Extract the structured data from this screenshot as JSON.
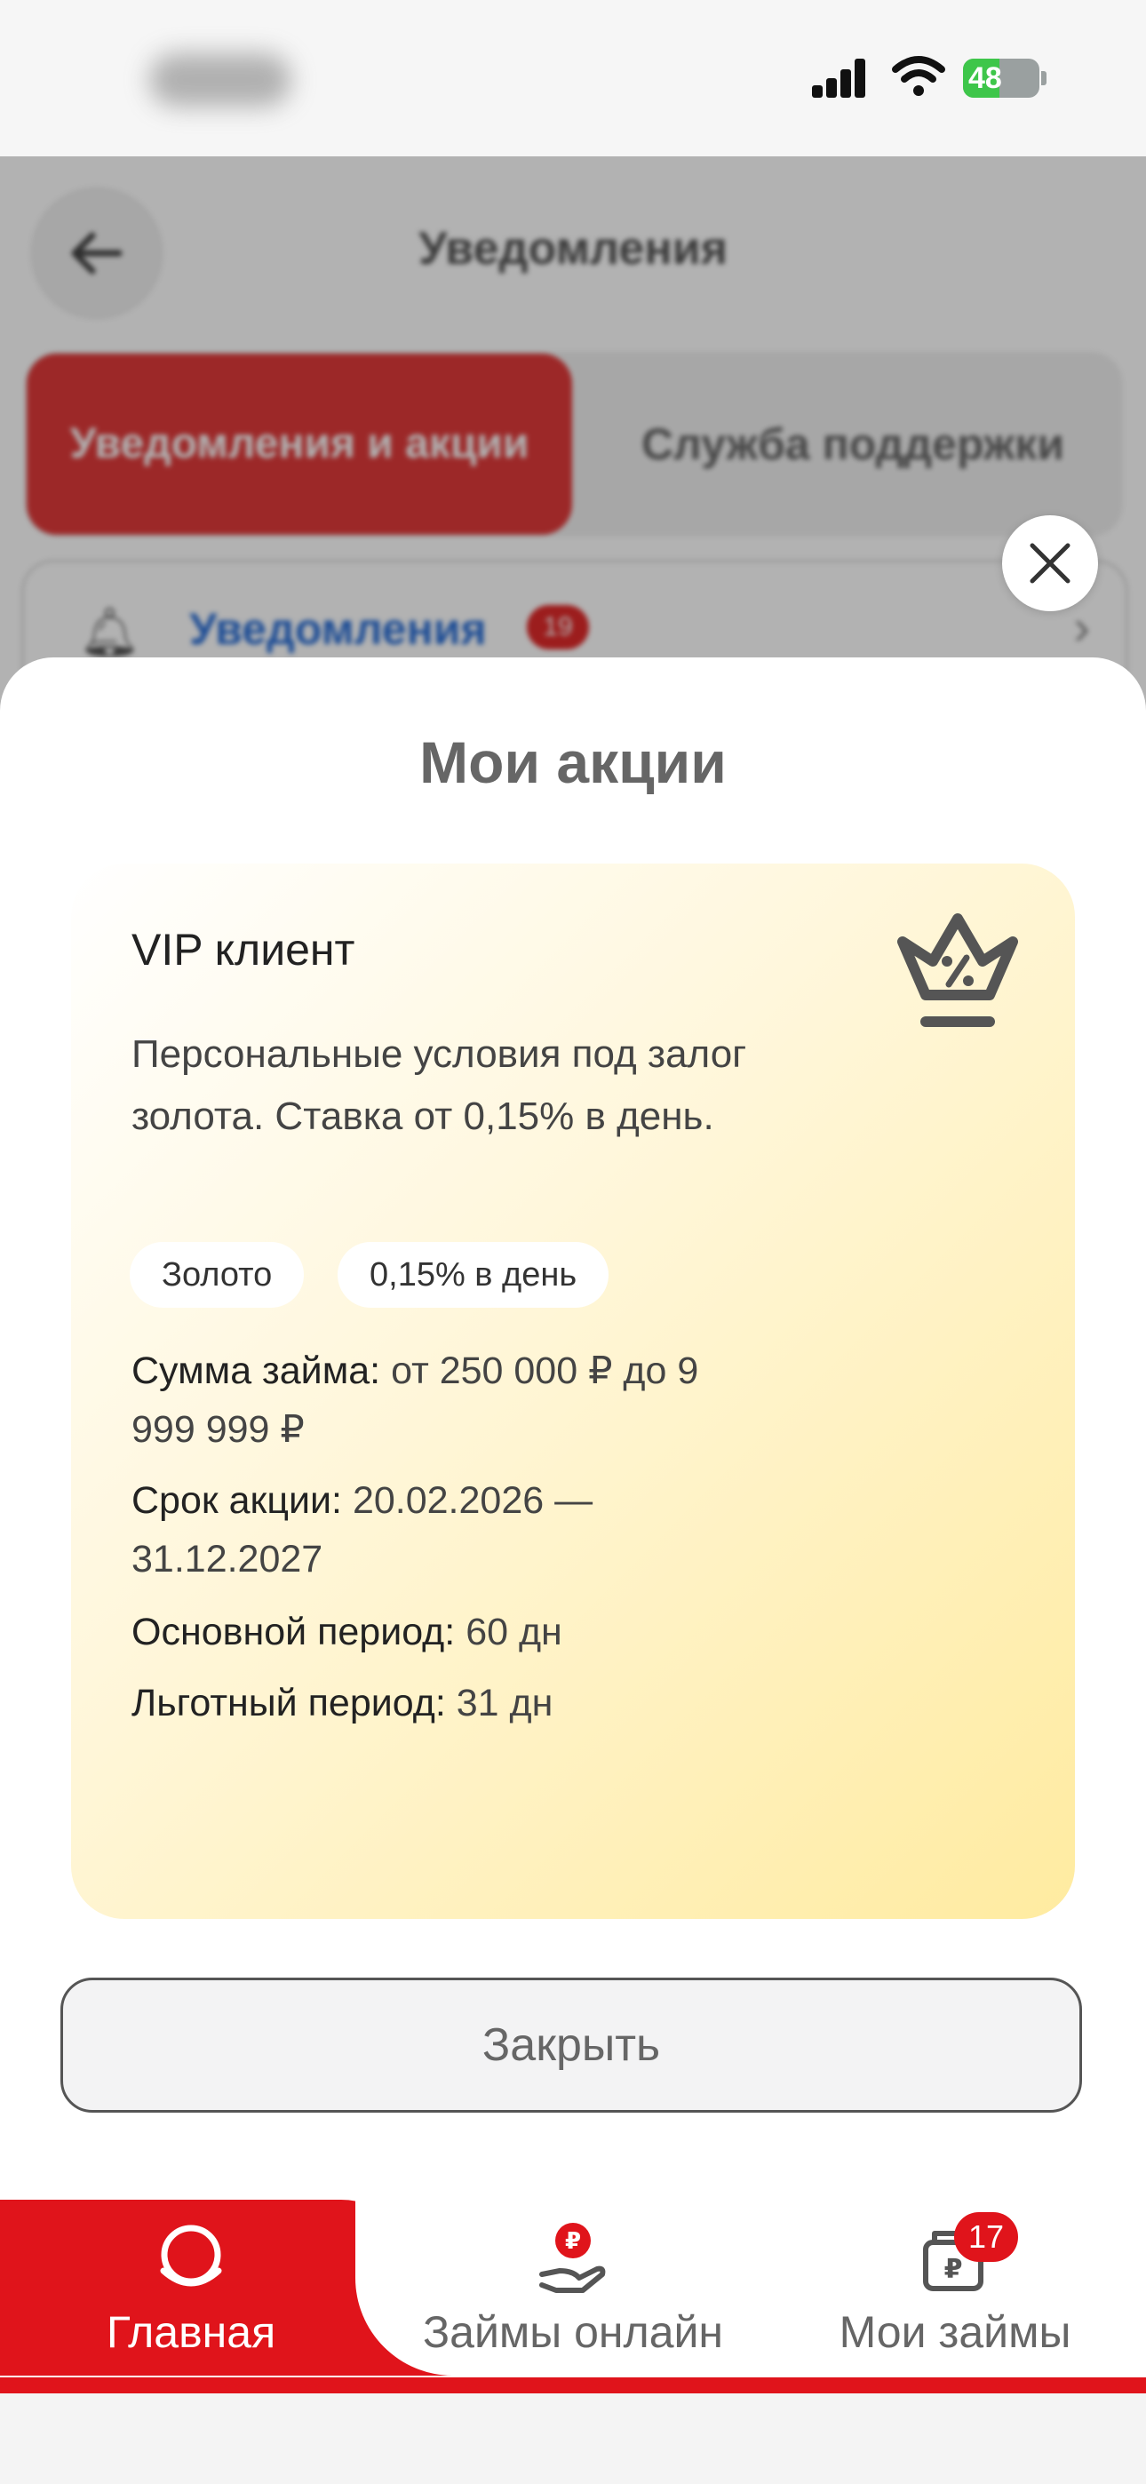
{
  "status_bar": {
    "battery_level": "48",
    "battery_fraction": 0.48
  },
  "background_page": {
    "title": "Уведомления",
    "segment_active": "Уведомления и акции",
    "segment_other": "Служба поддержки",
    "notifications_label": "Уведомления",
    "notifications_badge": "19"
  },
  "sheet": {
    "title": "Мои акции",
    "promo": {
      "title": "VIP клиент",
      "description": "Персональные условия под залог золота. Ставка от 0,15% в день.",
      "tags": [
        "Золото",
        "0,15% в день"
      ],
      "details": [
        {
          "label": "Сумма займа:",
          "value": "от 250 000 ₽ до 9 999 999 ₽"
        },
        {
          "label": "Срок акции:",
          "value": "20.02.2026 — 31.12.2027"
        },
        {
          "label": "Основной период:",
          "value": "60 дн"
        },
        {
          "label": "Льготный период:",
          "value": "31 дн"
        }
      ]
    },
    "close_button": "Закрыть"
  },
  "tabbar": {
    "tabs": [
      {
        "label": "Главная",
        "icon": "home-ring-icon"
      },
      {
        "label": "Займы онлайн",
        "icon": "online-loan-icon"
      },
      {
        "label": "Мои займы",
        "icon": "wallet-ruble-icon",
        "badge": "17"
      }
    ]
  },
  "colors": {
    "brand_red": "#e0141b",
    "promo_gold": "#ffeba0"
  }
}
